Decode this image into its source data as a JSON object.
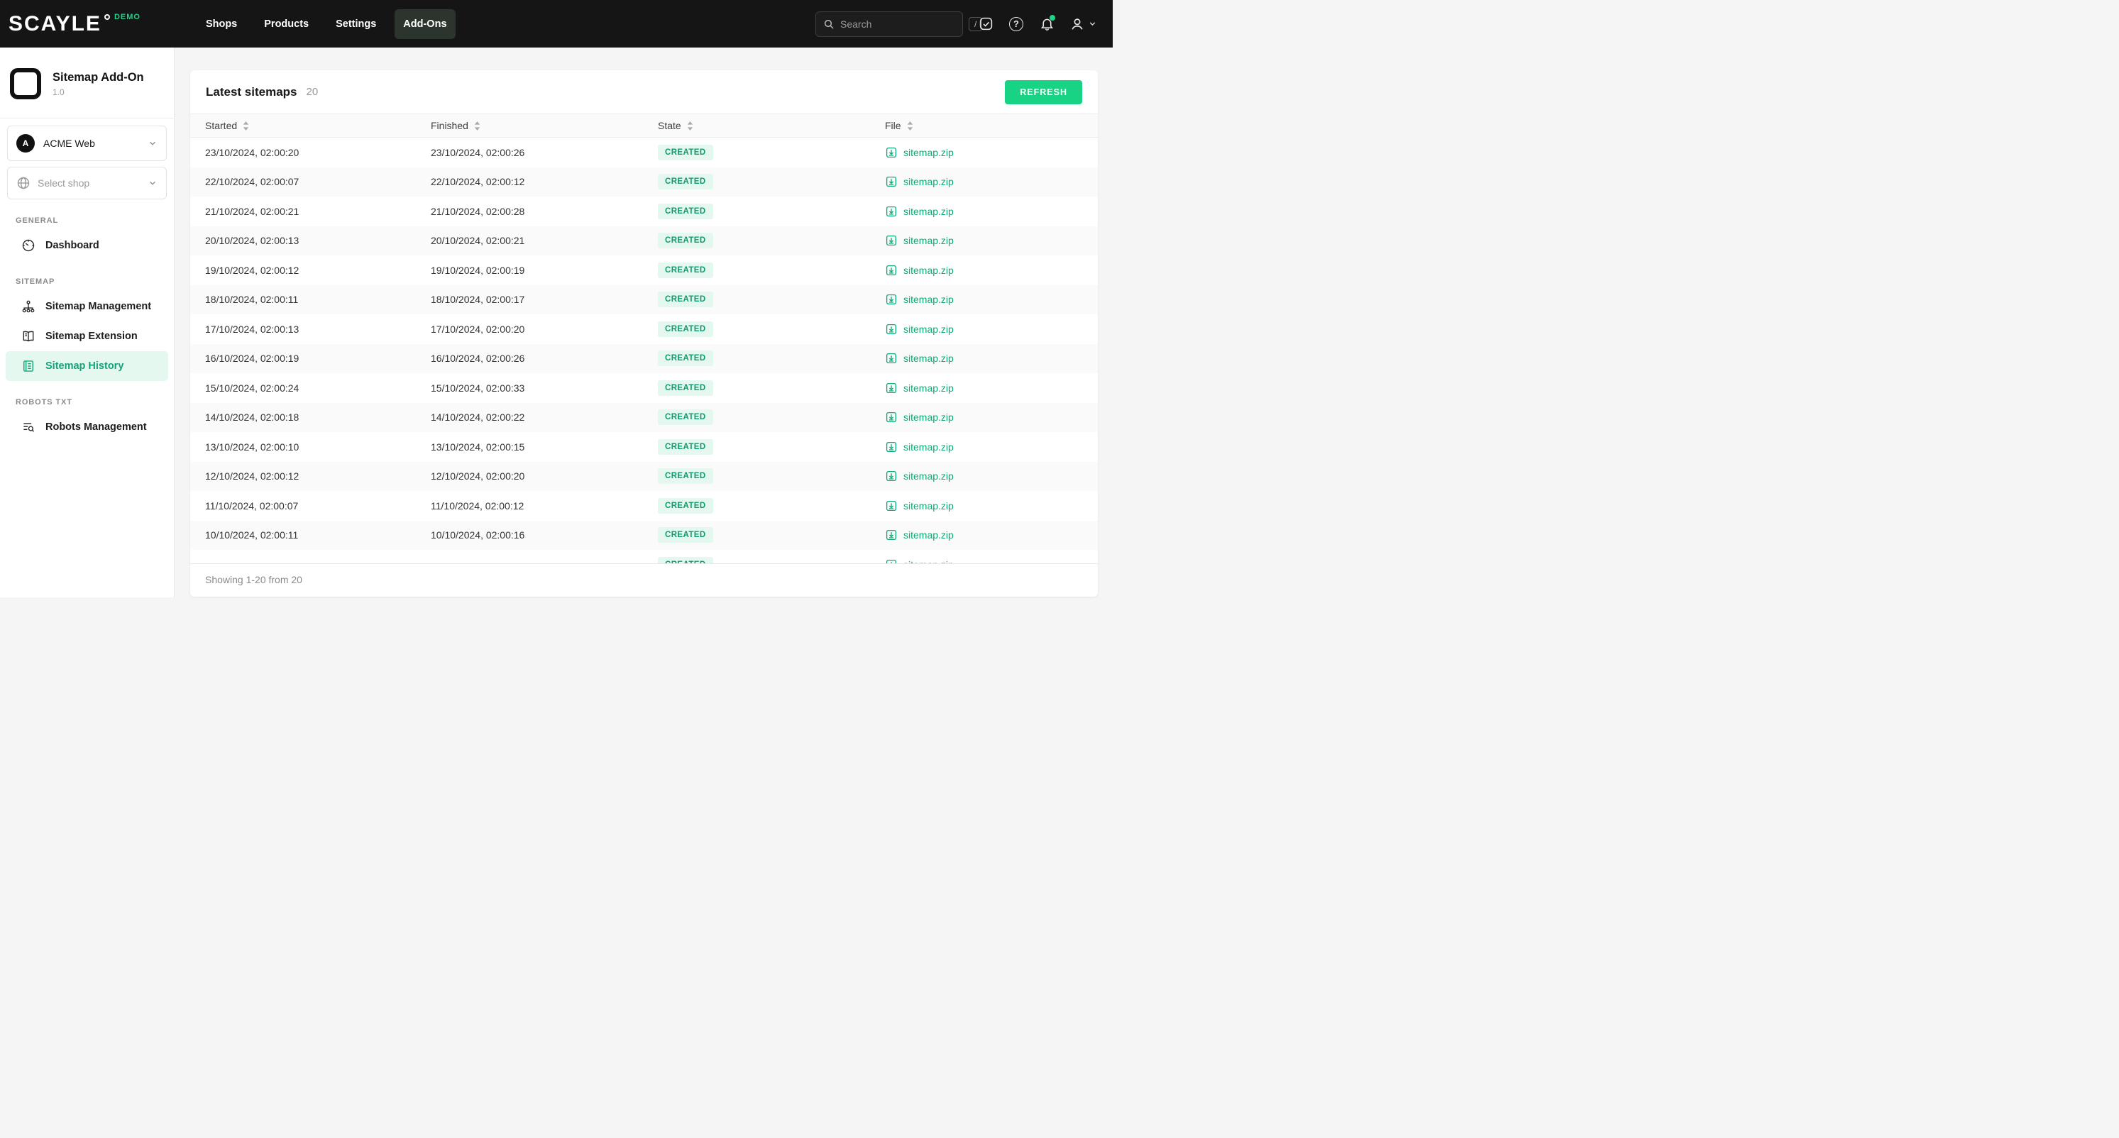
{
  "colors": {
    "accent": "#19D385",
    "accent_dark": "#0d9b6d",
    "badge_bg": "#e5f8f0",
    "topbar_bg": "#151515",
    "active_nav_bg": "#2b352e"
  },
  "topbar": {
    "logo": "SCAYLE",
    "env_badge": "DEMO",
    "nav": [
      {
        "label": "Shops"
      },
      {
        "label": "Products"
      },
      {
        "label": "Settings"
      },
      {
        "label": "Add-Ons",
        "active": true
      }
    ],
    "search": {
      "placeholder": "Search",
      "shortcut": "/"
    },
    "icons": [
      "check-badge-icon",
      "help-icon",
      "notifications-icon",
      "account-icon"
    ]
  },
  "sidebar": {
    "app": {
      "title": "Sitemap Add-On",
      "version": "1.0"
    },
    "tenant": {
      "name": "ACME Web",
      "initial": "A"
    },
    "shop_select": {
      "placeholder": "Select shop"
    },
    "sections": [
      {
        "label": "GENERAL",
        "items": [
          {
            "label": "Dashboard",
            "icon": "dashboard-icon"
          }
        ]
      },
      {
        "label": "SITEMAP",
        "items": [
          {
            "label": "Sitemap Management",
            "icon": "sitemap-icon"
          },
          {
            "label": "Sitemap Extension",
            "icon": "book-icon"
          },
          {
            "label": "Sitemap History",
            "icon": "document-icon",
            "active": true
          }
        ]
      },
      {
        "label": "ROBOTS TXT",
        "items": [
          {
            "label": "Robots Management",
            "icon": "list-search-icon"
          }
        ]
      }
    ]
  },
  "main": {
    "title": "Latest sitemaps",
    "count": "20",
    "refresh_label": "REFRESH",
    "table": {
      "columns": [
        "Started",
        "Finished",
        "State",
        "File"
      ],
      "rows": [
        {
          "started": "23/10/2024, 02:00:20",
          "finished": "23/10/2024, 02:00:26",
          "state": "CREATED",
          "file": "sitemap.zip"
        },
        {
          "started": "22/10/2024, 02:00:07",
          "finished": "22/10/2024, 02:00:12",
          "state": "CREATED",
          "file": "sitemap.zip"
        },
        {
          "started": "21/10/2024, 02:00:21",
          "finished": "21/10/2024, 02:00:28",
          "state": "CREATED",
          "file": "sitemap.zip"
        },
        {
          "started": "20/10/2024, 02:00:13",
          "finished": "20/10/2024, 02:00:21",
          "state": "CREATED",
          "file": "sitemap.zip"
        },
        {
          "started": "19/10/2024, 02:00:12",
          "finished": "19/10/2024, 02:00:19",
          "state": "CREATED",
          "file": "sitemap.zip"
        },
        {
          "started": "18/10/2024, 02:00:11",
          "finished": "18/10/2024, 02:00:17",
          "state": "CREATED",
          "file": "sitemap.zip"
        },
        {
          "started": "17/10/2024, 02:00:13",
          "finished": "17/10/2024, 02:00:20",
          "state": "CREATED",
          "file": "sitemap.zip"
        },
        {
          "started": "16/10/2024, 02:00:19",
          "finished": "16/10/2024, 02:00:26",
          "state": "CREATED",
          "file": "sitemap.zip"
        },
        {
          "started": "15/10/2024, 02:00:24",
          "finished": "15/10/2024, 02:00:33",
          "state": "CREATED",
          "file": "sitemap.zip"
        },
        {
          "started": "14/10/2024, 02:00:18",
          "finished": "14/10/2024, 02:00:22",
          "state": "CREATED",
          "file": "sitemap.zip"
        },
        {
          "started": "13/10/2024, 02:00:10",
          "finished": "13/10/2024, 02:00:15",
          "state": "CREATED",
          "file": "sitemap.zip"
        },
        {
          "started": "12/10/2024, 02:00:12",
          "finished": "12/10/2024, 02:00:20",
          "state": "CREATED",
          "file": "sitemap.zip"
        },
        {
          "started": "11/10/2024, 02:00:07",
          "finished": "11/10/2024, 02:00:12",
          "state": "CREATED",
          "file": "sitemap.zip"
        },
        {
          "started": "10/10/2024, 02:00:11",
          "finished": "10/10/2024, 02:00:16",
          "state": "CREATED",
          "file": "sitemap.zip"
        }
      ],
      "partial_row": {
        "started": "",
        "finished": "",
        "state": "CREATED",
        "file": "sitemap.zip"
      }
    },
    "footer": "Showing 1-20 from 20"
  }
}
